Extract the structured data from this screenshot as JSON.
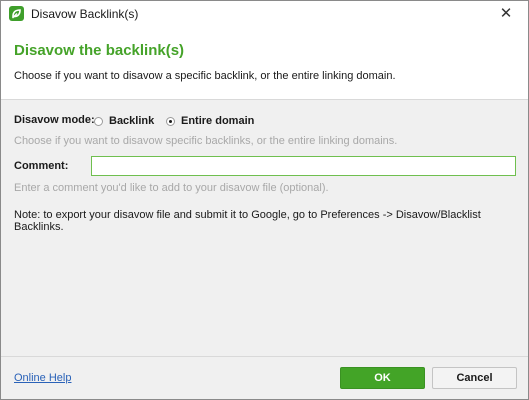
{
  "window": {
    "title": "Disavow Backlink(s)",
    "close_glyph": "✕"
  },
  "header": {
    "title": "Disavow the backlink(s)",
    "description": "Choose if you want to disavow a specific backlink, or the entire linking domain."
  },
  "mode": {
    "label": "Disavow mode:",
    "options": [
      {
        "label": "Backlink",
        "selected": false
      },
      {
        "label": "Entire domain",
        "selected": true
      }
    ],
    "hint": "Choose if you want to disavow specific backlinks, or the entire linking domains."
  },
  "comment": {
    "label": "Comment:",
    "value": "",
    "hint": "Enter a comment you'd like to add to your disavow file (optional)."
  },
  "note": "Note: to export your disavow file and submit it to Google, go to Preferences -> Disavow/Blacklist Backlinks.",
  "footer": {
    "help_link": "Online Help",
    "ok_label": "OK",
    "cancel_label": "Cancel"
  },
  "colors": {
    "accent": "#45a329",
    "button_ok": "#43a427",
    "link": "#2a62b8",
    "hint_text": "#a8a8a8"
  },
  "icons": {
    "app": "app-logo-icon",
    "close": "close-icon"
  }
}
